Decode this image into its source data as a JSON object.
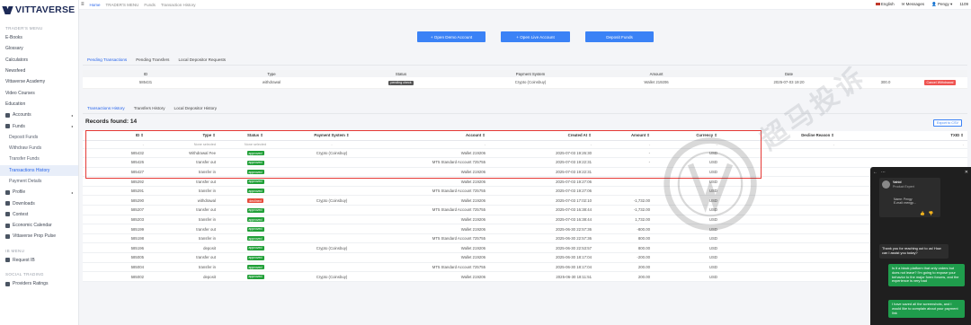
{
  "brand": {
    "name": "VITTAVERSE"
  },
  "topbar": {
    "breadcrumbs": [
      "Home",
      "TRADER'S MENU",
      "Funds",
      "Transaction History"
    ],
    "language": "English",
    "messages": "Messages",
    "user": "Pengy",
    "balance_badge": "1109"
  },
  "sidebar": {
    "section_traders": "TRADER'S MENU",
    "items": [
      "E-Books",
      "Glossary",
      "Calculators",
      "Newsfeed",
      "Vittaverse Academy",
      "Video Courses",
      "Education",
      "Accounts",
      "Funds",
      "Deposit Funds",
      "Withdraw Funds",
      "Transfer Funds",
      "Transactions History",
      "Payment Details",
      "Profile",
      "Downloads",
      "Contest",
      "Economic Calendar",
      "Vittaverse Prop Pulse"
    ],
    "section_ib": "IB MENU",
    "ib_items": [
      "Request IB"
    ],
    "section_social": "SOCIAL TRADING",
    "social_items": [
      "Providers Ratings"
    ]
  },
  "actions": {
    "open_demo": "+ Open Demo Account",
    "open_live": "+ Open Live Account",
    "deposit": "Deposit Funds"
  },
  "pending_tabs": [
    "Pending Transactions",
    "Pending Transfers",
    "Local Depositor Requests"
  ],
  "pending_table": {
    "headers": [
      "ID",
      "Type",
      "Status",
      "Payment System",
      "Amount",
      "Date",
      ""
    ],
    "row": {
      "id": "585431",
      "type": "withdrawal",
      "status": "pending check",
      "payment_system": "Crypto (Coinsbuy)",
      "amount": "Wallet 219206",
      "date": "2025-07-03 19:20",
      "extra": "300.0",
      "action": "Cancel Withdrawal"
    }
  },
  "history_tabs": [
    "Transactions History",
    "Transfers History",
    "Local Depositor History"
  ],
  "records_found": "Records found: 14",
  "export_label": "Export to CSV",
  "history_table": {
    "headers": [
      "ID ⇕",
      "Type ⇕",
      "Status ⇕",
      "Payment System ⇕",
      "Account ⇕",
      "Created At ⇕",
      "Amount ⇕",
      "Currency ⇕",
      "Decline Reason ⇕",
      "TXID ⇕"
    ],
    "filters": [
      "-",
      "None selected",
      "None selected",
      "-",
      "-",
      "-",
      "-",
      "-",
      "-",
      "-"
    ],
    "rows": [
      [
        "585432",
        "Withdrawal Fee",
        "approved",
        "Crypto (Coinsbuy)",
        "Wallet 219206",
        "2025-07-03 19:26:30",
        "-",
        "USD",
        "",
        ""
      ],
      [
        "585426",
        "transfer out",
        "approved",
        "",
        "MT5 Standard Account 725755",
        "2025-07-03 19:22:31",
        "-",
        "USD",
        "",
        ""
      ],
      [
        "585427",
        "transfer in",
        "approved",
        "",
        "Wallet 219206",
        "2025-07-03 19:22:31",
        "",
        "USD",
        "",
        ""
      ],
      [
        "585292",
        "transfer out",
        "approved",
        "",
        "Wallet 219206",
        "2025-07-03 19:27:06",
        "",
        "USD",
        "",
        ""
      ],
      [
        "585291",
        "transfer in",
        "approved",
        "",
        "MT5 Standard Account 725755",
        "2025-07-03 19:27:06",
        "",
        "USD",
        "",
        ""
      ],
      [
        "585290",
        "withdrawal",
        "declined",
        "Crypto (Coinsbuy)",
        "Wallet 219206",
        "2025-07-03 17:02:10",
        "-1,732.00",
        "USD",
        "",
        ""
      ],
      [
        "585207",
        "transfer out",
        "approved",
        "",
        "MT5 Standard Account 725755",
        "2025-07-03 16:38:44",
        "-1,732.00",
        "USD",
        "",
        ""
      ],
      [
        "585203",
        "transfer in",
        "approved",
        "",
        "Wallet 219206",
        "2025-07-03 16:38:44",
        "1,732.00",
        "USD",
        "",
        ""
      ],
      [
        "585199",
        "transfer out",
        "approved",
        "",
        "Wallet 219206",
        "2025-06-30 22:57:36",
        "-800.00",
        "USD",
        "",
        ""
      ],
      [
        "585198",
        "transfer in",
        "approved",
        "",
        "MT5 Standard Account 725755",
        "2025-06-30 22:57:36",
        "800.00",
        "USD",
        "",
        ""
      ],
      [
        "585196",
        "deposit",
        "approved",
        "Crypto (Coinsbuy)",
        "Wallet 219206",
        "2025-06-30 22:53:57",
        "800.00",
        "USD",
        "",
        ""
      ],
      [
        "585005",
        "transfer out",
        "approved",
        "",
        "Wallet 219206",
        "2025-06-30 18:17:04",
        "-200.00",
        "USD",
        "",
        ""
      ],
      [
        "585004",
        "transfer in",
        "approved",
        "",
        "MT5 Standard Account 725755",
        "2025-06-30 18:17:04",
        "200.00",
        "USD",
        "",
        ""
      ],
      [
        "585002",
        "deposit",
        "approved",
        "Crypto (Coinsbuy)",
        "Wallet 219206",
        "2025-06-30 18:11:51",
        "200.00",
        "USD",
        "",
        ""
      ]
    ]
  },
  "watermark_text": "超马投诉",
  "chat": {
    "agent_name": "Vahid",
    "agent_role": "Product Expert",
    "agent_lines": [
      "Name: Pengy",
      "E-mail: mengp..."
    ],
    "incoming": "Thank you for reaching out to us! How can I assist you today?",
    "outgoing_1": "Is it a black platform that only orders but does not leave? I'm going to expose your behavior to the major forex forums, and the experience is very bad",
    "outgoing_2": "I have saved all the screenshots, and I would like to complain about your payment link"
  },
  "colors": {
    "accent": "#3b82f6",
    "approved": "#21a038",
    "declined": "#e74c3c",
    "highlight": "#e53935"
  }
}
